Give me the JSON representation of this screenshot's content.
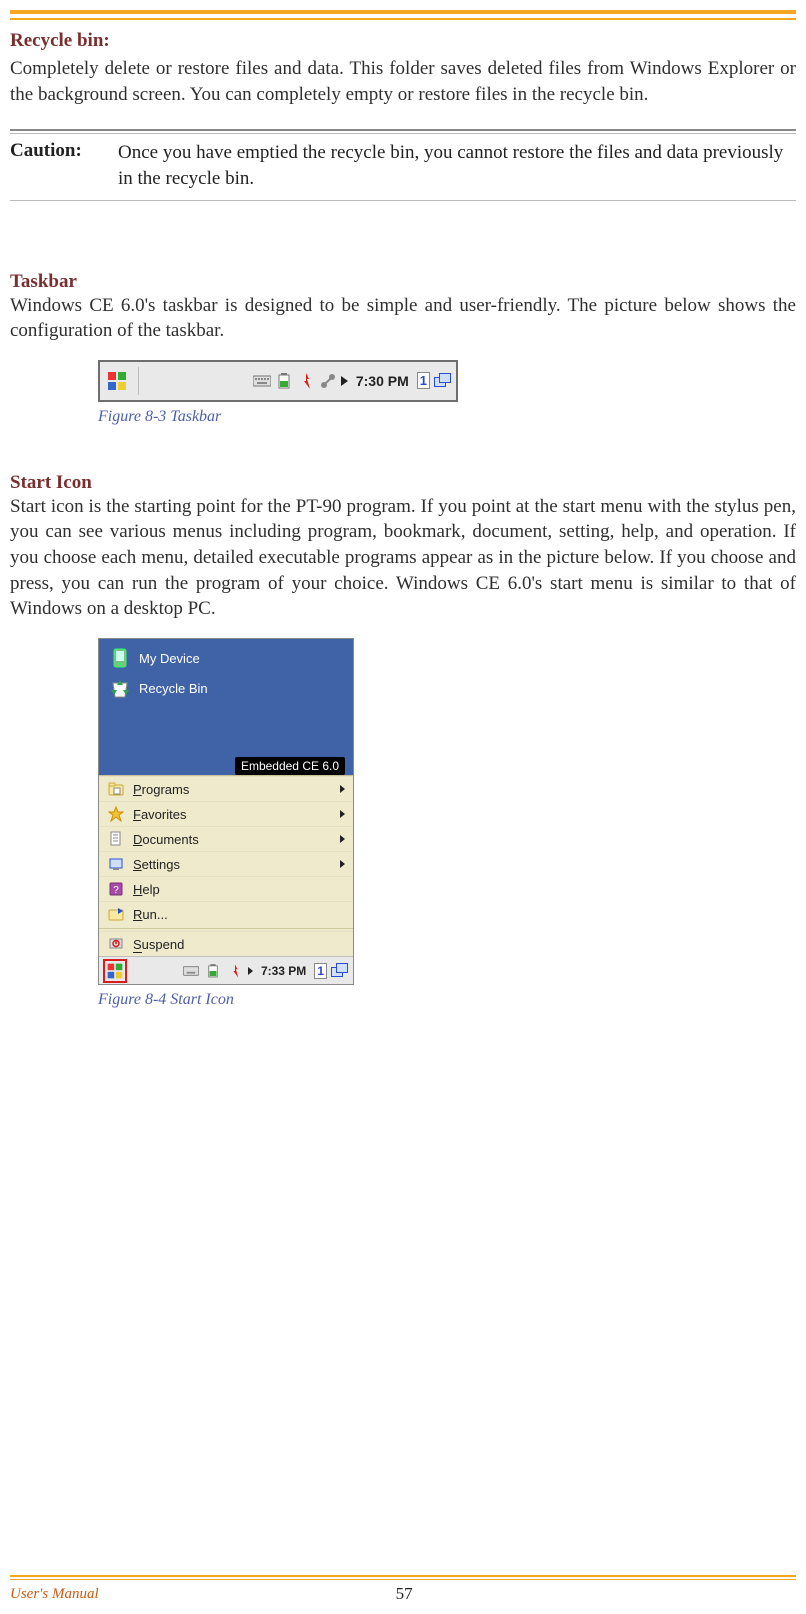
{
  "recycle": {
    "heading": "Recycle bin:",
    "body": "Completely delete or restore files and data. This folder saves deleted files from Windows Explorer or the background screen. You can completely empty or restore files in the recycle bin."
  },
  "caution": {
    "label": "Caution:",
    "text": "Once you have emptied the recycle bin, you cannot restore the files and data previously in the recycle bin."
  },
  "taskbar": {
    "heading": "Taskbar",
    "body": "Windows CE 6.0's taskbar is designed to be simple and user-friendly. The picture below shows the configuration of the taskbar.",
    "figure_caption": "Figure 8-3 Taskbar",
    "clock": "7:30 PM",
    "kbd": "1"
  },
  "starticon": {
    "heading": "Start Icon",
    "body": "Start icon is the starting point for the PT-90 program. If you point at the start menu with the stylus pen, you can see various menus including program, bookmark, document, setting, help, and operation. If you choose each menu, detailed executable programs appear as in the picture below. If you choose and press, you can run the program of your choice. Windows CE 6.0's start menu is similar to that of Windows on a desktop PC.",
    "figure_caption": "Figure 8-4 Start Icon",
    "desktop": {
      "my_device": "My Device",
      "recycle_bin": "Recycle Bin",
      "brand": "Embedded CE 6.0"
    },
    "menu": {
      "programs": "Programs",
      "favorites": "Favorites",
      "documents": "Documents",
      "settings": "Settings",
      "help": "Help",
      "run": "Run...",
      "suspend": "Suspend"
    },
    "taskbar": {
      "clock": "7:33 PM",
      "kbd": "1"
    }
  },
  "footer": {
    "left": "User's Manual",
    "page": "57"
  }
}
